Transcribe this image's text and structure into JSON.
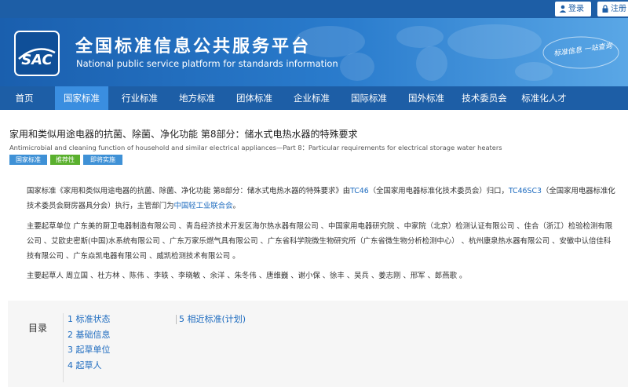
{
  "topbar": {
    "login_label": "登录",
    "register_label": "注册"
  },
  "banner": {
    "title": "全国标准信息公共服务平台",
    "subtitle": "National public service platform  for standards information",
    "slogan": "标准信息 一站查询"
  },
  "nav": {
    "items": [
      {
        "label": "首页",
        "active": false
      },
      {
        "label": "国家标准",
        "active": true
      },
      {
        "label": "行业标准",
        "active": false
      },
      {
        "label": "地方标准",
        "active": false
      },
      {
        "label": "团体标准",
        "active": false
      },
      {
        "label": "企业标准",
        "active": false
      },
      {
        "label": "国际标准",
        "active": false
      },
      {
        "label": "国外标准",
        "active": false
      },
      {
        "label": "技术委员会",
        "active": false
      },
      {
        "label": "标准化人才",
        "active": false
      }
    ]
  },
  "standard": {
    "title": "家用和类似用途电器的抗菌、除菌、净化功能 第8部分：储水式电热水器的特殊要求",
    "title_en": "Antimicrobial and cleaning function of household and similar electrical appliances—Part 8：Particular requirements for electrical storage water heaters",
    "badges": [
      {
        "label": "国家标准",
        "color": "#3f91d6"
      },
      {
        "label": "推荐性",
        "color": "#5ab02e"
      },
      {
        "label": "即将实施",
        "color": "#3f91d6"
      }
    ]
  },
  "intro": {
    "p1_a": "国家标准《家用和类似用途电器的抗菌、除菌、净化功能 第8部分：储水式电热水器的特殊要求》由",
    "p1_tc": "TC46",
    "p1_b": "（全国家用电器标准化技术委员会）归口，",
    "p1_sc": "TC46SC3",
    "p1_c": "（全国家用电器标准化技术委员会厨房器具分会）执行，主管部门为",
    "p1_dept": "中国轻工业联合会",
    "p1_end": "。",
    "p2": "主要起草单位 广东美的厨卫电器制造有限公司 、青岛经济技术开发区海尔热水器有限公司 、中国家用电器研究院 、中家院（北京）检测认证有限公司 、佳合（浙江）检验检测有限公司 、艾欧史密斯(中国)水系统有限公司 、广东万家乐燃气具有限公司 、广东省科学院微生物研究所（广东省微生物分析检测中心） 、杭州康泉热水器有限公司 、安徽中认倍佳科技有限公司 、广东焱凯电器有限公司 、威凯检测技术有限公司 。",
    "p3": "主要起草人 周立国 、杜方林 、陈伟 、李轶 、李晓敏 、余洋 、朱冬伟 、唐维巍 、谢小保 、徐丰 、吴兵 、姜志刚 、邢军 、郎燕歌 。"
  },
  "toc": {
    "label": "目录",
    "items": [
      {
        "label": "1  标准状态"
      },
      {
        "label": "2  基础信息"
      },
      {
        "label": "3  起草单位"
      },
      {
        "label": "4  起草人"
      },
      {
        "label": "5  相近标准(计划)"
      }
    ]
  },
  "colors": {
    "brand": "#1d5ea6",
    "nav_active": "#3a8ee0",
    "link": "#1d6bbf"
  },
  "icons": {
    "login": "user-icon",
    "register": "lock-icon",
    "logo": "sac-logo"
  }
}
